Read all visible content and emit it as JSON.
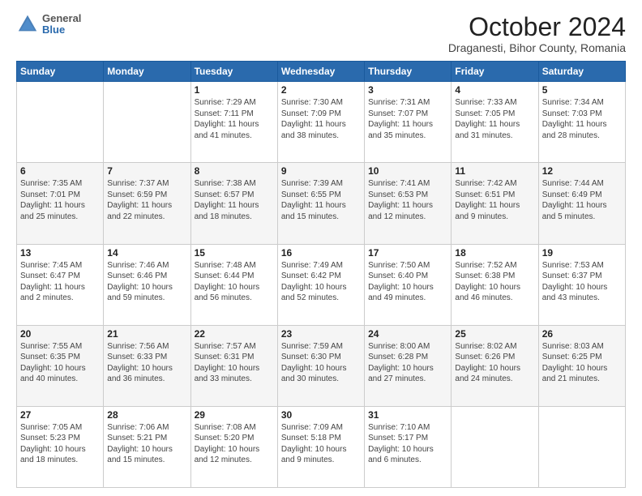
{
  "header": {
    "logo_general": "General",
    "logo_blue": "Blue",
    "month": "October 2024",
    "location": "Draganesti, Bihor County, Romania"
  },
  "days_of_week": [
    "Sunday",
    "Monday",
    "Tuesday",
    "Wednesday",
    "Thursday",
    "Friday",
    "Saturday"
  ],
  "weeks": [
    [
      {
        "day": "",
        "info": ""
      },
      {
        "day": "",
        "info": ""
      },
      {
        "day": "1",
        "info": "Sunrise: 7:29 AM\nSunset: 7:11 PM\nDaylight: 11 hours and 41 minutes."
      },
      {
        "day": "2",
        "info": "Sunrise: 7:30 AM\nSunset: 7:09 PM\nDaylight: 11 hours and 38 minutes."
      },
      {
        "day": "3",
        "info": "Sunrise: 7:31 AM\nSunset: 7:07 PM\nDaylight: 11 hours and 35 minutes."
      },
      {
        "day": "4",
        "info": "Sunrise: 7:33 AM\nSunset: 7:05 PM\nDaylight: 11 hours and 31 minutes."
      },
      {
        "day": "5",
        "info": "Sunrise: 7:34 AM\nSunset: 7:03 PM\nDaylight: 11 hours and 28 minutes."
      }
    ],
    [
      {
        "day": "6",
        "info": "Sunrise: 7:35 AM\nSunset: 7:01 PM\nDaylight: 11 hours and 25 minutes."
      },
      {
        "day": "7",
        "info": "Sunrise: 7:37 AM\nSunset: 6:59 PM\nDaylight: 11 hours and 22 minutes."
      },
      {
        "day": "8",
        "info": "Sunrise: 7:38 AM\nSunset: 6:57 PM\nDaylight: 11 hours and 18 minutes."
      },
      {
        "day": "9",
        "info": "Sunrise: 7:39 AM\nSunset: 6:55 PM\nDaylight: 11 hours and 15 minutes."
      },
      {
        "day": "10",
        "info": "Sunrise: 7:41 AM\nSunset: 6:53 PM\nDaylight: 11 hours and 12 minutes."
      },
      {
        "day": "11",
        "info": "Sunrise: 7:42 AM\nSunset: 6:51 PM\nDaylight: 11 hours and 9 minutes."
      },
      {
        "day": "12",
        "info": "Sunrise: 7:44 AM\nSunset: 6:49 PM\nDaylight: 11 hours and 5 minutes."
      }
    ],
    [
      {
        "day": "13",
        "info": "Sunrise: 7:45 AM\nSunset: 6:47 PM\nDaylight: 11 hours and 2 minutes."
      },
      {
        "day": "14",
        "info": "Sunrise: 7:46 AM\nSunset: 6:46 PM\nDaylight: 10 hours and 59 minutes."
      },
      {
        "day": "15",
        "info": "Sunrise: 7:48 AM\nSunset: 6:44 PM\nDaylight: 10 hours and 56 minutes."
      },
      {
        "day": "16",
        "info": "Sunrise: 7:49 AM\nSunset: 6:42 PM\nDaylight: 10 hours and 52 minutes."
      },
      {
        "day": "17",
        "info": "Sunrise: 7:50 AM\nSunset: 6:40 PM\nDaylight: 10 hours and 49 minutes."
      },
      {
        "day": "18",
        "info": "Sunrise: 7:52 AM\nSunset: 6:38 PM\nDaylight: 10 hours and 46 minutes."
      },
      {
        "day": "19",
        "info": "Sunrise: 7:53 AM\nSunset: 6:37 PM\nDaylight: 10 hours and 43 minutes."
      }
    ],
    [
      {
        "day": "20",
        "info": "Sunrise: 7:55 AM\nSunset: 6:35 PM\nDaylight: 10 hours and 40 minutes."
      },
      {
        "day": "21",
        "info": "Sunrise: 7:56 AM\nSunset: 6:33 PM\nDaylight: 10 hours and 36 minutes."
      },
      {
        "day": "22",
        "info": "Sunrise: 7:57 AM\nSunset: 6:31 PM\nDaylight: 10 hours and 33 minutes."
      },
      {
        "day": "23",
        "info": "Sunrise: 7:59 AM\nSunset: 6:30 PM\nDaylight: 10 hours and 30 minutes."
      },
      {
        "day": "24",
        "info": "Sunrise: 8:00 AM\nSunset: 6:28 PM\nDaylight: 10 hours and 27 minutes."
      },
      {
        "day": "25",
        "info": "Sunrise: 8:02 AM\nSunset: 6:26 PM\nDaylight: 10 hours and 24 minutes."
      },
      {
        "day": "26",
        "info": "Sunrise: 8:03 AM\nSunset: 6:25 PM\nDaylight: 10 hours and 21 minutes."
      }
    ],
    [
      {
        "day": "27",
        "info": "Sunrise: 7:05 AM\nSunset: 5:23 PM\nDaylight: 10 hours and 18 minutes."
      },
      {
        "day": "28",
        "info": "Sunrise: 7:06 AM\nSunset: 5:21 PM\nDaylight: 10 hours and 15 minutes."
      },
      {
        "day": "29",
        "info": "Sunrise: 7:08 AM\nSunset: 5:20 PM\nDaylight: 10 hours and 12 minutes."
      },
      {
        "day": "30",
        "info": "Sunrise: 7:09 AM\nSunset: 5:18 PM\nDaylight: 10 hours and 9 minutes."
      },
      {
        "day": "31",
        "info": "Sunrise: 7:10 AM\nSunset: 5:17 PM\nDaylight: 10 hours and 6 minutes."
      },
      {
        "day": "",
        "info": ""
      },
      {
        "day": "",
        "info": ""
      }
    ]
  ]
}
